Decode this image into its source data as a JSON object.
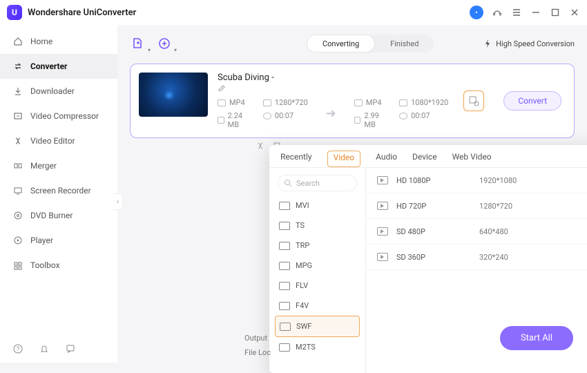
{
  "app": {
    "title": "Wondershare UniConverter"
  },
  "titlebar_icons": {
    "avatar_initial": "•"
  },
  "sidebar": {
    "items": [
      {
        "label": "Home",
        "icon": "home-icon"
      },
      {
        "label": "Converter",
        "icon": "converter-icon"
      },
      {
        "label": "Downloader",
        "icon": "downloader-icon"
      },
      {
        "label": "Video Compressor",
        "icon": "compressor-icon"
      },
      {
        "label": "Video Editor",
        "icon": "editor-icon"
      },
      {
        "label": "Merger",
        "icon": "merger-icon"
      },
      {
        "label": "Screen Recorder",
        "icon": "recorder-icon"
      },
      {
        "label": "DVD Burner",
        "icon": "dvd-icon"
      },
      {
        "label": "Player",
        "icon": "player-icon"
      },
      {
        "label": "Toolbox",
        "icon": "toolbox-icon"
      }
    ],
    "active_index": 1
  },
  "topbar": {
    "segment": {
      "converting": "Converting",
      "finished": "Finished",
      "active": "converting"
    },
    "high_speed": "High Speed Conversion"
  },
  "file": {
    "name": "Scuba Diving",
    "name_suffix": " - ",
    "source": {
      "format": "MP4",
      "resolution": "1280*720",
      "size": "2.24 MB",
      "duration": "00:07"
    },
    "target": {
      "format": "MP4",
      "resolution": "1080*1920",
      "size": "2.99 MB",
      "duration": "00:07"
    },
    "convert_label": "Convert"
  },
  "popup": {
    "tabs": [
      "Recently",
      "Video",
      "Audio",
      "Device",
      "Web Video"
    ],
    "active_tab_index": 1,
    "search_placeholder": "Search",
    "formats": [
      "MVI",
      "TS",
      "TRP",
      "MPG",
      "FLV",
      "F4V",
      "SWF",
      "M2TS"
    ],
    "selected_format_index": 6,
    "presets": [
      {
        "name": "HD 1080P",
        "res": "1920*1080"
      },
      {
        "name": "HD 720P",
        "res": "1280*720"
      },
      {
        "name": "SD 480P",
        "res": "640*480"
      },
      {
        "name": "SD 360P",
        "res": "320*240"
      }
    ]
  },
  "footer": {
    "output_label": "Output",
    "fileloc_label": "File Loc",
    "start_all": "Start All"
  }
}
